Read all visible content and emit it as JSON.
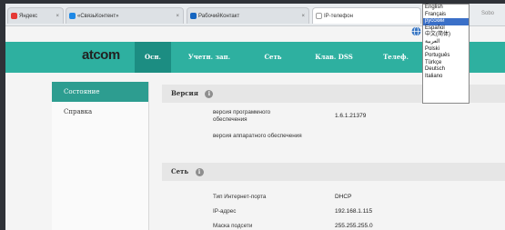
{
  "browser": {
    "tabs": [
      {
        "label": "Яндекс",
        "color": "#e53935"
      },
      {
        "label": "«СвязьКонтент»",
        "color": "#1e88e5"
      },
      {
        "label": "РабочийКонтакт",
        "color": "#1565c0"
      },
      {
        "label": "IP-телефон",
        "color": "#9e9e9e"
      }
    ],
    "corner_text": "Sobo"
  },
  "language_menu": {
    "options": [
      "English",
      "Français",
      "русский",
      "Español",
      "中文(简体)",
      "العربية",
      "Polski",
      "Português",
      "Türkçe",
      "Deutsch",
      "Italiano"
    ],
    "selected": "русский"
  },
  "app": {
    "logo": "atcom",
    "nav": [
      "Осн.",
      "Учетн. зап.",
      "Сеть",
      "Клав. DSS",
      "Телеф."
    ],
    "sidebar": [
      "Состояние",
      "Справка"
    ],
    "sections": [
      {
        "title": "Версия",
        "rows": [
          {
            "label": "версия программного обеспечения",
            "value": "1.6.1.21379"
          },
          {
            "label": "версия аппаратного обеспечения",
            "value": ""
          }
        ]
      },
      {
        "title": "Сеть",
        "rows": [
          {
            "label": "Тип Интернет-порта",
            "value": "DHCP"
          },
          {
            "label": "IP-адрес",
            "value": "192.168.1.115"
          },
          {
            "label": "Маска подсети",
            "value": "255.255.255.0"
          }
        ]
      }
    ]
  },
  "colors": {
    "nav_bg": "#2eb0a0",
    "nav_active": "#1c8d82",
    "sidebar_active": "#2d9d90"
  }
}
